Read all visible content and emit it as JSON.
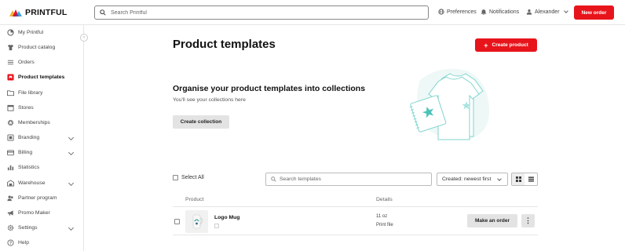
{
  "app": {
    "logo_text": "PRINTFUL",
    "search_placeholder": "Search Printful",
    "preferences_label": "Preferences",
    "notifications_label": "Notifications",
    "user_name": "Alexander",
    "new_order_label": "New order"
  },
  "sidebar": {
    "items": [
      {
        "label": "My Printful",
        "icon": "dashboard-icon",
        "chevron": false
      },
      {
        "label": "Product catalog",
        "icon": "shirt-icon",
        "chevron": false
      },
      {
        "label": "Orders",
        "icon": "list-icon",
        "chevron": false
      },
      {
        "label": "Product templates",
        "icon": "template-icon",
        "chevron": false,
        "active": true
      },
      {
        "label": "File library",
        "icon": "folder-icon",
        "chevron": false
      },
      {
        "label": "Stores",
        "icon": "store-icon",
        "chevron": false
      },
      {
        "label": "Memberships",
        "icon": "membership-icon",
        "chevron": false
      },
      {
        "label": "Branding",
        "icon": "branding-icon",
        "chevron": true
      },
      {
        "label": "Billing",
        "icon": "card-icon",
        "chevron": true
      },
      {
        "label": "Statistics",
        "icon": "stats-icon",
        "chevron": false
      },
      {
        "label": "Warehouse",
        "icon": "warehouse-icon",
        "chevron": true
      },
      {
        "label": "Partner program",
        "icon": "partner-icon",
        "chevron": false
      },
      {
        "label": "Promo Maker",
        "icon": "megaphone-icon",
        "chevron": false
      },
      {
        "label": "Settings",
        "icon": "gear-icon",
        "chevron": true
      },
      {
        "label": "Help",
        "icon": "help-icon",
        "chevron": false
      }
    ]
  },
  "main": {
    "title": "Product templates",
    "create_product_label": "Create product",
    "collections": {
      "title": "Organise your product templates into collections",
      "subtitle": "You'll see your collections here",
      "button_label": "Create collection"
    },
    "toolbar": {
      "select_all_label": "Select All",
      "search_placeholder": "Search templates",
      "sort_value": "Created: newest first"
    },
    "table": {
      "headers": {
        "product": "Product",
        "details": "Details"
      },
      "rows": [
        {
          "name": "Logo Mug",
          "detail_1": "11 oz",
          "detail_2": "Print file",
          "action_label": "Make an order",
          "more_label": "⋮"
        }
      ]
    }
  },
  "colors": {
    "accent": "#e8141b",
    "illustration": "#7fd5cf"
  }
}
